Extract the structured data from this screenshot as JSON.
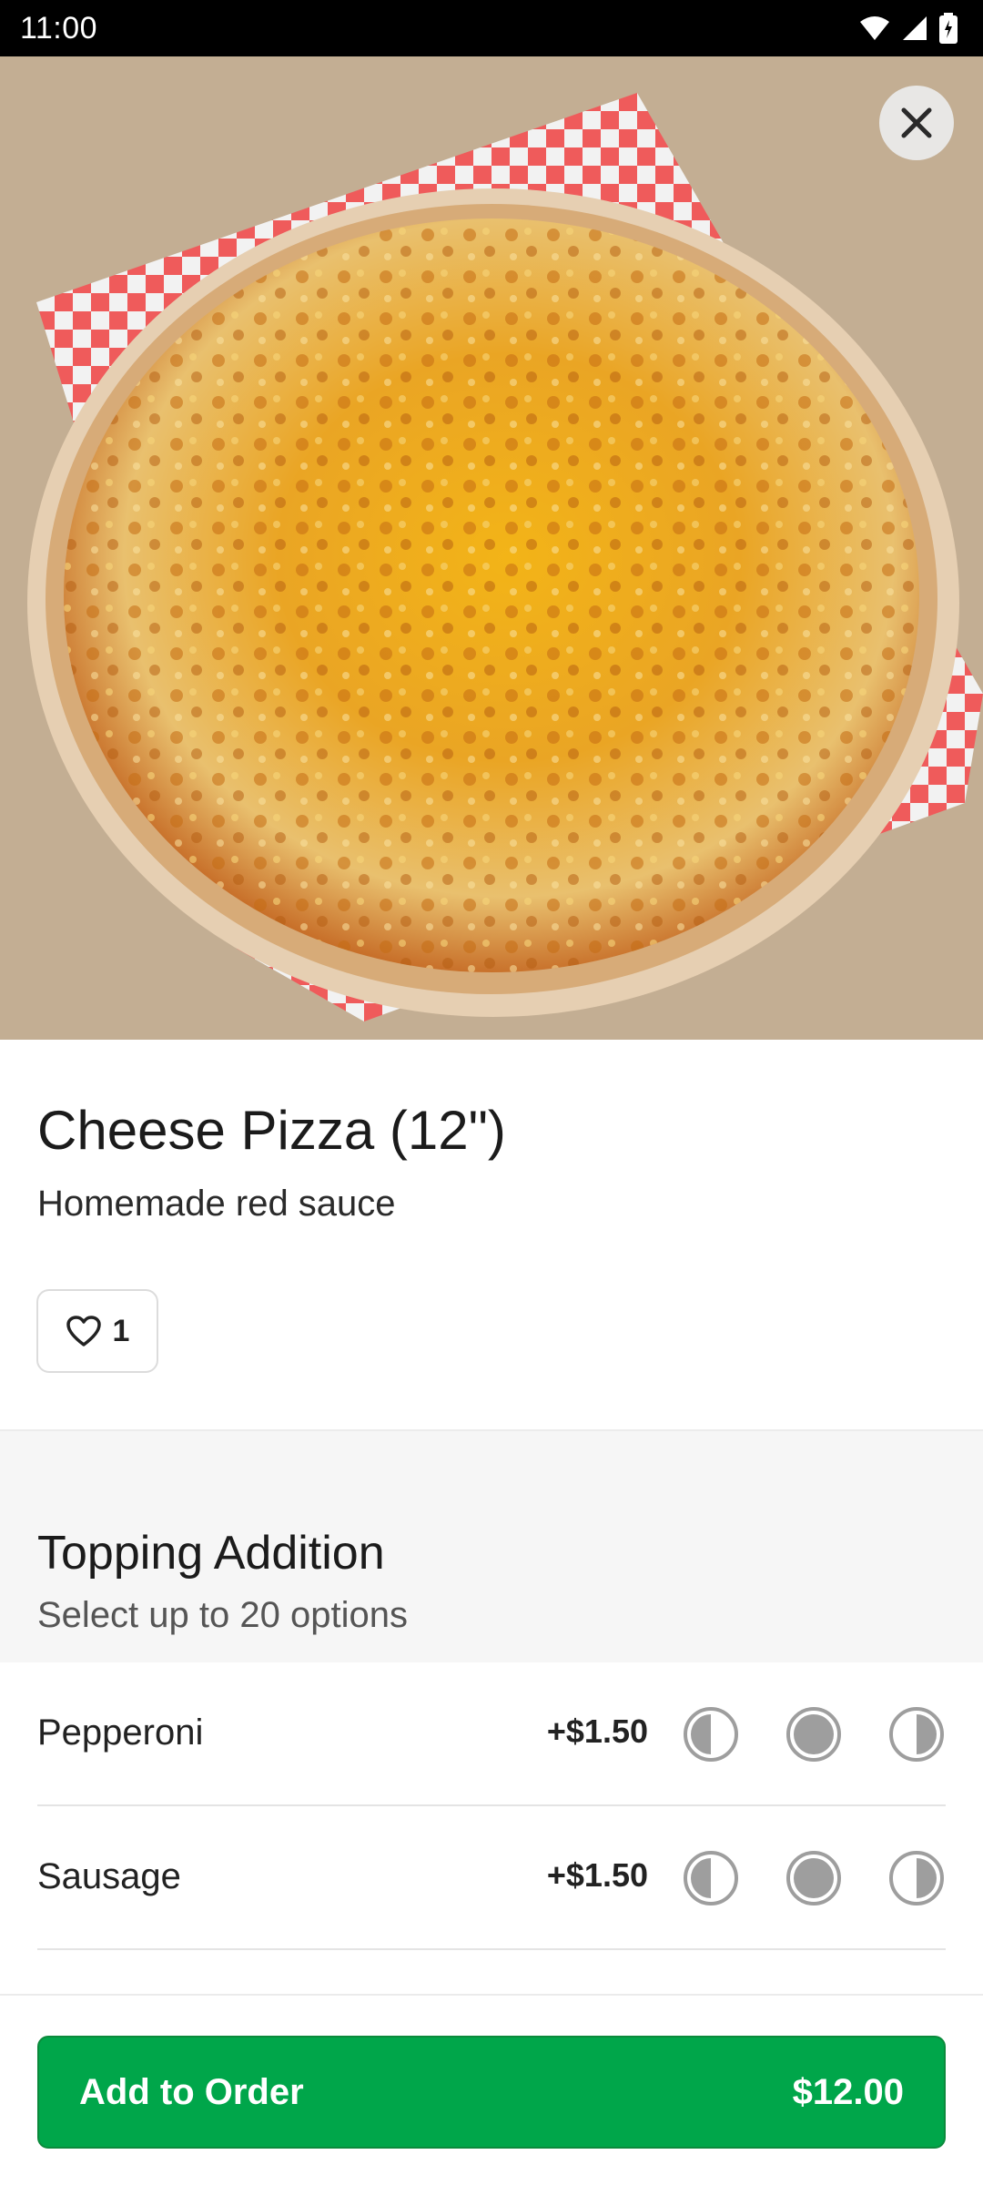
{
  "status_bar": {
    "time": "11:00"
  },
  "item": {
    "title": "Cheese Pizza (12\")",
    "description": "Homemade red sauce",
    "favorite_count": "1"
  },
  "section": {
    "title": "Topping Addition",
    "subtitle": "Select up to 20 options",
    "options": [
      {
        "name": "Pepperoni",
        "price": "+$1.50"
      },
      {
        "name": "Sausage",
        "price": "+$1.50"
      }
    ]
  },
  "footer": {
    "add_label": "Add to Order",
    "total": "$12.00"
  },
  "icons": {
    "close": "close-icon",
    "favorite": "heart-icon",
    "placement": [
      "left-half-icon",
      "whole-icon",
      "right-half-icon"
    ]
  },
  "colors": {
    "accent": "#00a64a",
    "placement_icon": "#9e9e9e"
  }
}
